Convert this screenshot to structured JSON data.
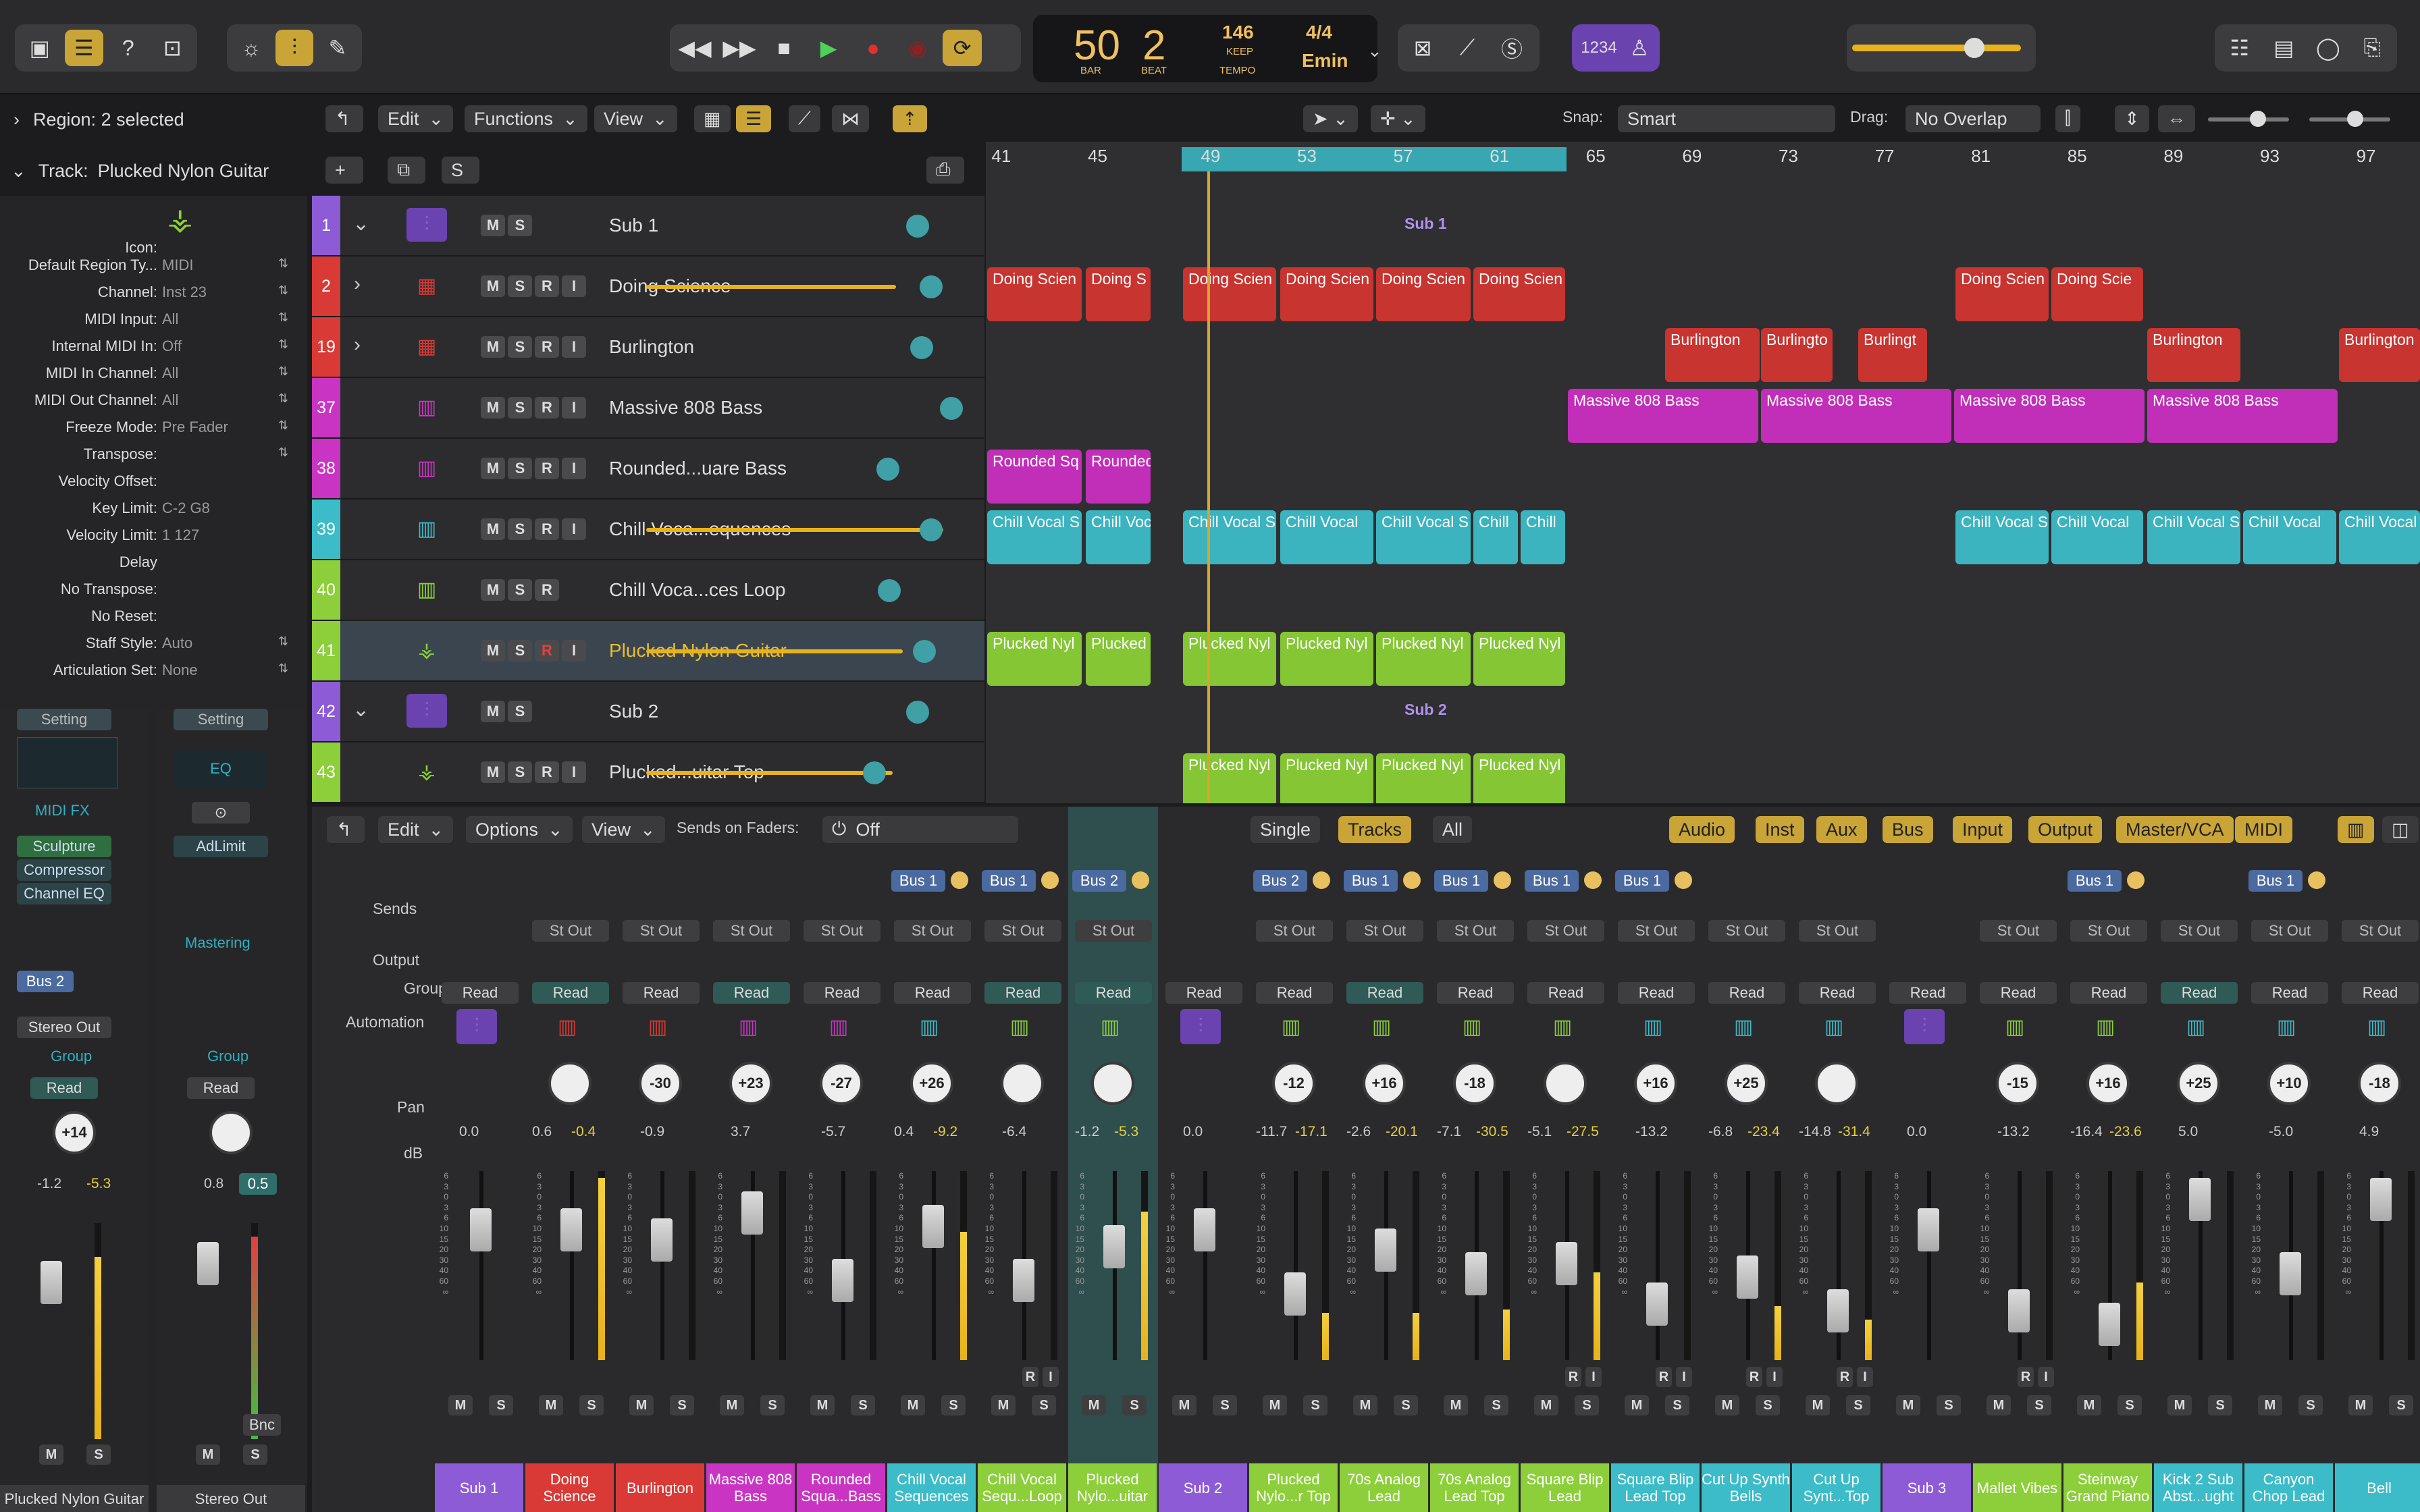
{
  "control_bar": {
    "lcd": {
      "bar": "50",
      "bar_label": "BAR",
      "beat": "2",
      "beat_label": "BEAT",
      "tempo": "146",
      "tempo_mode": "KEEP",
      "tempo_label": "TEMPO",
      "signature": "4/4",
      "key": "Emin"
    },
    "count_in": "1234"
  },
  "region_bar": {
    "label": "Region: 2 selected"
  },
  "track_bar": {
    "label": "Track:",
    "name": "Plucked Nylon Guitar"
  },
  "arrange_menus": [
    "Edit",
    "Functions",
    "View"
  ],
  "snap": {
    "label": "Snap:",
    "value": "Smart"
  },
  "drag": {
    "label": "Drag:",
    "value": "No Overlap"
  },
  "inspector": {
    "rows": [
      {
        "label": "Icon:",
        "value": ""
      },
      {
        "label": "Default Region Ty...",
        "value": "MIDI"
      },
      {
        "label": "Channel:",
        "value": "Inst 23"
      },
      {
        "label": "MIDI Input:",
        "value": "All"
      },
      {
        "label": "Internal MIDI In:",
        "value": "Off"
      },
      {
        "label": "MIDI In Channel:",
        "value": "All"
      },
      {
        "label": "MIDI Out Channel:",
        "value": "All"
      },
      {
        "label": "Freeze Mode:",
        "value": "Pre Fader"
      },
      {
        "label": "Transpose:",
        "value": ""
      },
      {
        "label": "Velocity Offset:",
        "value": ""
      },
      {
        "label": "Key Limit:",
        "value": "C-2  G8"
      },
      {
        "label": "Velocity Limit:",
        "value": "1  127"
      },
      {
        "label": "Delay",
        "value": ""
      },
      {
        "label": "No Transpose:",
        "value": ""
      },
      {
        "label": "No Reset:",
        "value": ""
      },
      {
        "label": "Staff Style:",
        "value": "Auto"
      },
      {
        "label": "Articulation Set:",
        "value": "None"
      }
    ],
    "strip1": {
      "setting": "Setting",
      "midi_fx": "MIDI FX",
      "plugins": [
        "Sculpture",
        "Compressor",
        "Channel EQ"
      ],
      "send": "Bus 2",
      "output": "Stereo Out",
      "group": "Group",
      "automation": "Read",
      "pan": "+14",
      "db": "-1.2",
      "peak": "-5.3",
      "name": "Plucked Nylon Guitar"
    },
    "strip2": {
      "setting": "Setting",
      "eq": "EQ",
      "plugins": [
        "AdLimit"
      ],
      "mastering": "Mastering",
      "group": "Group",
      "automation": "Read",
      "db": "0.8",
      "peak": "0.5",
      "bnc": "Bnc",
      "name": "Stereo Out"
    }
  },
  "tracks": [
    {
      "num": "1",
      "name": "Sub 1",
      "color": "#8e5bd6"
    },
    {
      "num": "2",
      "name": "Doing Science",
      "color": "#d93a35"
    },
    {
      "num": "19",
      "name": "Burlington",
      "color": "#d93a35"
    },
    {
      "num": "37",
      "name": "Massive 808 Bass",
      "color": "#c935c2"
    },
    {
      "num": "38",
      "name": "Rounded...uare Bass",
      "color": "#c935c2"
    },
    {
      "num": "39",
      "name": "Chill Voca...equences",
      "color": "#3bbcc8"
    },
    {
      "num": "40",
      "name": "Chill Voca...ces Loop",
      "color": "#8ccf3a"
    },
    {
      "num": "41",
      "name": "Plucked Nylon Guitar",
      "color": "#8ccf3a"
    },
    {
      "num": "42",
      "name": "Sub 2",
      "color": "#8e5bd6"
    },
    {
      "num": "43",
      "name": "Plucked...uitar Top",
      "color": "#8ccf3a"
    }
  ],
  "ruler": [
    "41",
    "45",
    "49",
    "53",
    "57",
    "61",
    "65",
    "69",
    "73",
    "77",
    "81",
    "85",
    "89",
    "93",
    "97"
  ],
  "folder_labels": {
    "sub1": "Sub 1",
    "sub2": "Sub 2"
  },
  "regions": {
    "doing": [
      "Doing Scien",
      "Doing S",
      "Doing Scien",
      "Doing Scien",
      "Doing Scien",
      "Doing Scien",
      "Doing Scien",
      "Doing Scie"
    ],
    "burl": [
      "Burlington",
      "Burlingto",
      "Burlingt",
      "Burlington",
      "Burlington"
    ],
    "massive": [
      "Massive 808 Bass",
      "Massive 808 Bass",
      "Massive 808 Bass",
      "Massive 808 Bass"
    ],
    "rounded": [
      "Rounded Sq",
      "Rounded"
    ],
    "chill": [
      "Chill Vocal S",
      "Chill Voc",
      "Chill Vocal S",
      "Chill Vocal",
      "Chill Vocal S",
      "Chill",
      "Chill",
      "Chill Vocal S",
      "Chill Vocal",
      "Chill Vocal S",
      "Chill Vocal",
      "Chill Vocal"
    ],
    "pluck": [
      "Plucked Nyl",
      "Plucked",
      "Plucked Nyl",
      "Plucked Nyl",
      "Plucked Nyl",
      "Plucked Nyl"
    ],
    "pluck_top": [
      "Plucked Nyl",
      "Plucked Nyl",
      "Plucked Nyl",
      "Plucked Nyl"
    ]
  },
  "mixer": {
    "menus": [
      "Edit",
      "Options",
      "View"
    ],
    "sends_on_faders": "Sends on Faders:",
    "sends_value": "Off",
    "views": [
      "Single",
      "Tracks",
      "All"
    ],
    "filters": [
      "Audio",
      "Inst",
      "Aux",
      "Bus",
      "Input",
      "Output",
      "Master/VCA",
      "MIDI"
    ],
    "row_labels": [
      "Sends",
      "Output",
      "Group",
      "Automation",
      "Pan",
      "dB"
    ],
    "strips": [
      {
        "name": "Sub 1",
        "color": "#8e5bd6",
        "send": "",
        "out": "",
        "auto": "Read",
        "pan": "",
        "db": "0.0",
        "peak": "",
        "ri": false
      },
      {
        "name": "Doing Science",
        "color": "#d93a35",
        "send": "",
        "out": "St Out",
        "auto": "Read",
        "pan": "",
        "db": "0.6",
        "peak": "-0.4",
        "ri": false
      },
      {
        "name": "Burlington",
        "color": "#d93a35",
        "send": "",
        "out": "St Out",
        "auto": "Read",
        "pan": "-30",
        "db": "-0.9",
        "peak": "",
        "ri": false
      },
      {
        "name": "Massive 808 Bass",
        "color": "#c935c2",
        "send": "",
        "out": "St Out",
        "auto": "Read",
        "pan": "+23",
        "db": "3.7",
        "peak": "",
        "ri": false
      },
      {
        "name": "Rounded Squa...Bass",
        "color": "#c935c2",
        "send": "",
        "out": "St Out",
        "auto": "Read",
        "pan": "-27",
        "db": "-5.7",
        "peak": "",
        "ri": false
      },
      {
        "name": "Chill Vocal Sequences",
        "color": "#3bbcc8",
        "send": "Bus 1",
        "out": "St Out",
        "auto": "Read",
        "pan": "+26",
        "db": "0.4",
        "peak": "-9.2",
        "ri": false
      },
      {
        "name": "Chill Vocal Sequ...Loop",
        "color": "#8ccf3a",
        "send": "Bus 1",
        "out": "St Out",
        "auto": "Read",
        "pan": "",
        "db": "-6.4",
        "peak": "",
        "ri": true
      },
      {
        "name": "Plucked Nylo...uitar",
        "color": "#8ccf3a",
        "send": "Bus 2",
        "out": "St Out",
        "auto": "Read",
        "pan": "",
        "db": "-1.2",
        "peak": "-5.3",
        "ri": false
      },
      {
        "name": "Sub 2",
        "color": "#8e5bd6",
        "send": "",
        "out": "",
        "auto": "Read",
        "pan": "",
        "db": "0.0",
        "peak": "",
        "ri": false
      },
      {
        "name": "Plucked Nylo...r Top",
        "color": "#8ccf3a",
        "send": "Bus 2",
        "out": "St Out",
        "auto": "Read",
        "pan": "-12",
        "db": "-11.7",
        "peak": "-17.1",
        "ri": false
      },
      {
        "name": "70s Analog Lead",
        "color": "#8ccf3a",
        "send": "Bus 1",
        "out": "St Out",
        "auto": "Read",
        "pan": "+16",
        "db": "-2.6",
        "peak": "-20.1",
        "ri": false
      },
      {
        "name": "70s Analog Lead Top",
        "color": "#8ccf3a",
        "send": "Bus 1",
        "out": "St Out",
        "auto": "Read",
        "pan": "-18",
        "db": "-7.1",
        "peak": "-30.5",
        "ri": false
      },
      {
        "name": "Square Blip Lead",
        "color": "#8ccf3a",
        "send": "Bus 1",
        "out": "St Out",
        "auto": "Read",
        "pan": "",
        "db": "-5.1",
        "peak": "-27.5",
        "ri": true
      },
      {
        "name": "Square Blip Lead Top",
        "color": "#3bbcc8",
        "send": "Bus 1",
        "out": "St Out",
        "auto": "Read",
        "pan": "+16",
        "db": "-13.2",
        "peak": "",
        "ri": true
      },
      {
        "name": "Cut Up Synth Bells",
        "color": "#3bbcc8",
        "send": "",
        "out": "St Out",
        "auto": "Read",
        "pan": "+25",
        "db": "-6.8",
        "peak": "-23.4",
        "ri": true
      },
      {
        "name": "Cut Up Synt...Top",
        "color": "#3bbcc8",
        "send": "",
        "out": "St Out",
        "auto": "Read",
        "pan": "",
        "db": "-14.8",
        "peak": "-31.4",
        "ri": true
      },
      {
        "name": "Sub 3",
        "color": "#8e5bd6",
        "send": "",
        "out": "",
        "auto": "Read",
        "pan": "",
        "db": "0.0",
        "peak": "",
        "ri": false
      },
      {
        "name": "Mallet Vibes",
        "color": "#8ccf3a",
        "send": "",
        "out": "St Out",
        "auto": "Read",
        "pan": "-15",
        "db": "-13.2",
        "peak": "",
        "ri": true
      },
      {
        "name": "Steinway Grand Piano",
        "color": "#8ccf3a",
        "send": "Bus 1",
        "out": "St Out",
        "auto": "Read",
        "pan": "+16",
        "db": "-16.4",
        "peak": "-23.6",
        "ri": false
      },
      {
        "name": "Kick 2 Sub Abst...ught",
        "color": "#3bbcc8",
        "send": "",
        "out": "St Out",
        "auto": "Read",
        "pan": "+25",
        "db": "5.0",
        "peak": "",
        "ri": false
      },
      {
        "name": "Canyon Chop Lead",
        "color": "#3bbcc8",
        "send": "Bus 1",
        "out": "St Out",
        "auto": "Read",
        "pan": "+10",
        "db": "-5.0",
        "peak": "",
        "ri": false
      },
      {
        "name": "Bell",
        "color": "#3bbcc8",
        "send": "",
        "out": "St Out",
        "auto": "Read",
        "pan": "-18",
        "db": "4.9",
        "peak": "",
        "ri": false
      }
    ]
  }
}
